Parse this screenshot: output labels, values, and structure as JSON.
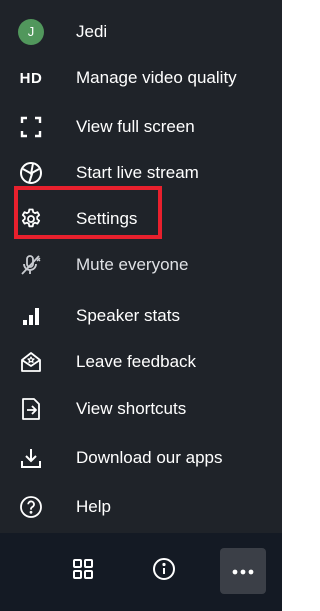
{
  "menu": {
    "items": [
      {
        "label": "Jedi",
        "icon": "avatar",
        "avatar_letter": "J"
      },
      {
        "label": "Manage video quality",
        "icon": "hd-icon",
        "icon_text": "HD"
      },
      {
        "label": "View full screen",
        "icon": "fullscreen-icon"
      },
      {
        "label": "Start live stream",
        "icon": "live-stream-icon"
      },
      {
        "label": "Settings",
        "icon": "gear-icon",
        "highlighted": true
      },
      {
        "label": "Mute everyone",
        "icon": "mute-everyone-icon"
      },
      {
        "label": "Speaker stats",
        "icon": "speaker-stats-icon"
      },
      {
        "label": "Leave feedback",
        "icon": "feedback-icon"
      },
      {
        "label": "View shortcuts",
        "icon": "shortcuts-icon"
      },
      {
        "label": "Download our apps",
        "icon": "download-icon"
      },
      {
        "label": "Help",
        "icon": "help-icon"
      }
    ]
  },
  "toolbar": {
    "buttons": [
      {
        "icon": "grid-view-icon"
      },
      {
        "icon": "info-icon"
      },
      {
        "icon": "more-options-icon",
        "active": true
      }
    ]
  },
  "colors": {
    "menu_background": "#1f2329",
    "toolbar_background": "#141a24",
    "highlight_border": "#e8202d",
    "avatar_background": "#51975c",
    "text": "#ffffff"
  }
}
